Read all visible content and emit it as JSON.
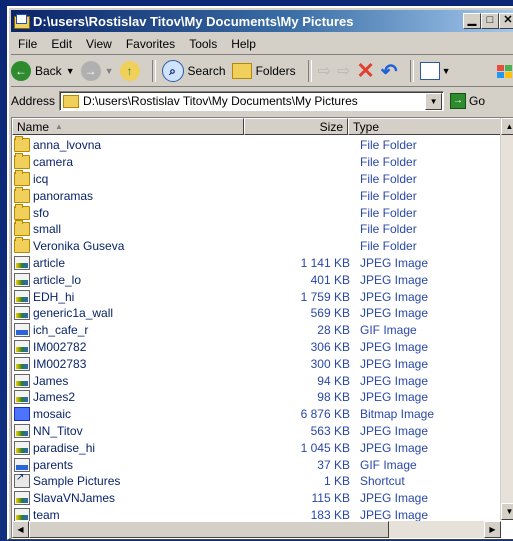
{
  "window": {
    "title": "D:\\users\\Rostislav Titov\\My Documents\\My Pictures"
  },
  "menu": [
    {
      "label": "File"
    },
    {
      "label": "Edit"
    },
    {
      "label": "View"
    },
    {
      "label": "Favorites"
    },
    {
      "label": "Tools"
    },
    {
      "label": "Help"
    }
  ],
  "toolbar": {
    "back": "Back",
    "search": "Search",
    "folders": "Folders"
  },
  "address": {
    "label": "Address",
    "value": "D:\\users\\Rostislav Titov\\My Documents\\My Pictures",
    "go": "Go"
  },
  "columns": {
    "name": "Name",
    "size": "Size",
    "type": "Type"
  },
  "rows": [
    {
      "name": "anna_lvovna",
      "size": "",
      "type": "File Folder",
      "icon": "folder"
    },
    {
      "name": "camera",
      "size": "",
      "type": "File Folder",
      "icon": "folder"
    },
    {
      "name": "icq",
      "size": "",
      "type": "File Folder",
      "icon": "folder"
    },
    {
      "name": "panoramas",
      "size": "",
      "type": "File Folder",
      "icon": "folder"
    },
    {
      "name": "sfo",
      "size": "",
      "type": "File Folder",
      "icon": "folder"
    },
    {
      "name": "small",
      "size": "",
      "type": "File Folder",
      "icon": "folder"
    },
    {
      "name": "Veronika Guseva",
      "size": "",
      "type": "File Folder",
      "icon": "folder"
    },
    {
      "name": "article",
      "size": "1 141 KB",
      "type": "JPEG Image",
      "icon": "jpeg"
    },
    {
      "name": "article_lo",
      "size": "401 KB",
      "type": "JPEG Image",
      "icon": "jpeg"
    },
    {
      "name": "EDH_hi",
      "size": "1 759 KB",
      "type": "JPEG Image",
      "icon": "jpeg"
    },
    {
      "name": "generic1a_wall",
      "size": "569 KB",
      "type": "JPEG Image",
      "icon": "jpeg"
    },
    {
      "name": "ich_cafe_r",
      "size": "28 KB",
      "type": "GIF Image",
      "icon": "gif"
    },
    {
      "name": "IM002782",
      "size": "306 KB",
      "type": "JPEG Image",
      "icon": "jpeg"
    },
    {
      "name": "IM002783",
      "size": "300 KB",
      "type": "JPEG Image",
      "icon": "jpeg"
    },
    {
      "name": "James",
      "size": "94 KB",
      "type": "JPEG Image",
      "icon": "jpeg"
    },
    {
      "name": "James2",
      "size": "98 KB",
      "type": "JPEG Image",
      "icon": "jpeg"
    },
    {
      "name": "mosaic",
      "size": "6 876 KB",
      "type": "Bitmap Image",
      "icon": "bmp"
    },
    {
      "name": "NN_Titov",
      "size": "563 KB",
      "type": "JPEG Image",
      "icon": "jpeg"
    },
    {
      "name": "paradise_hi",
      "size": "1 045 KB",
      "type": "JPEG Image",
      "icon": "jpeg"
    },
    {
      "name": "parents",
      "size": "37 KB",
      "type": "GIF Image",
      "icon": "gif"
    },
    {
      "name": "Sample Pictures",
      "size": "1 KB",
      "type": "Shortcut",
      "icon": "shortcut"
    },
    {
      "name": "SlavaVNJames",
      "size": "115 KB",
      "type": "JPEG Image",
      "icon": "jpeg"
    },
    {
      "name": "team",
      "size": "183 KB",
      "type": "JPEG Image",
      "icon": "jpeg"
    }
  ]
}
